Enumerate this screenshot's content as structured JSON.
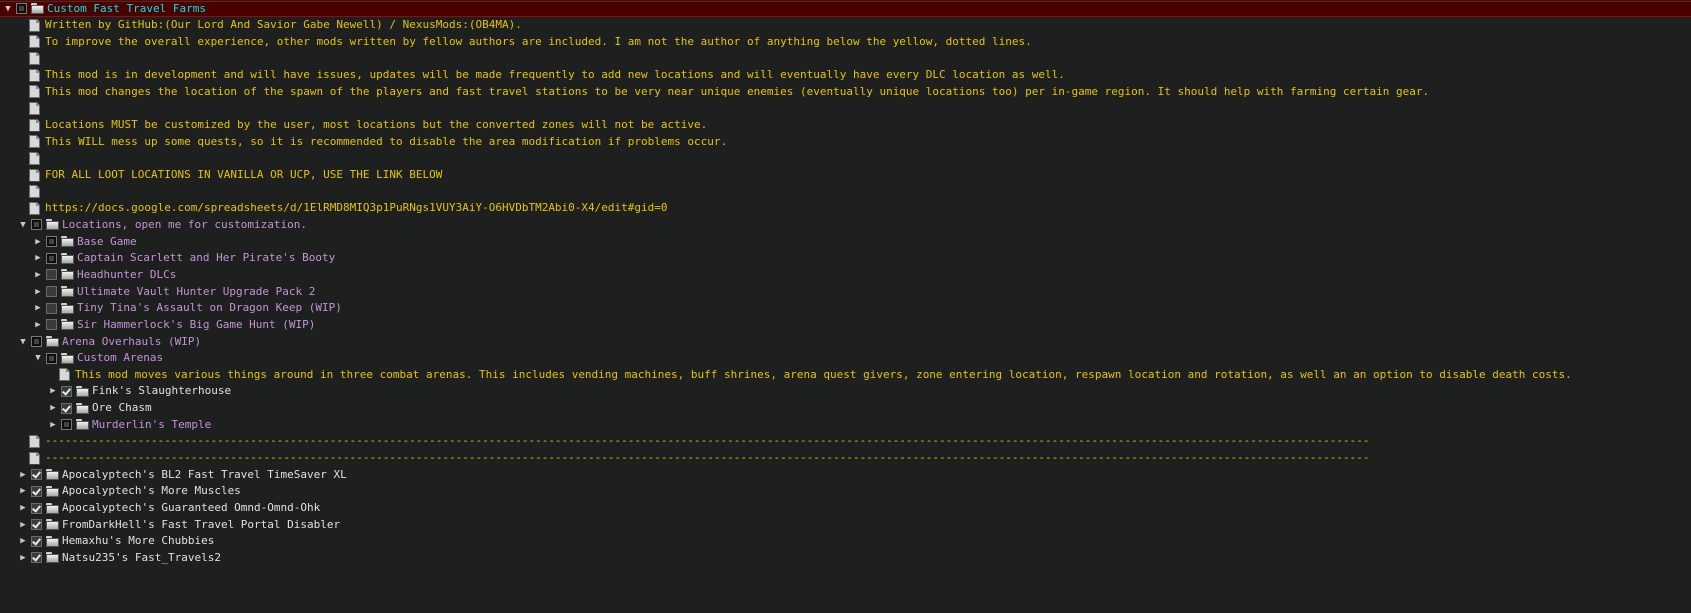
{
  "colors": {
    "background": "#1e1f1f",
    "selected_row": "#4a0000",
    "root_text": "#00e6e6",
    "note_text": "#e6c400",
    "category_text": "#c493d6",
    "mod_text": "#e0e0e0"
  },
  "tree": {
    "rows": [
      {
        "label": "Custom Fast Travel Farms",
        "type": "folder",
        "depth": 0,
        "expander": "expanded",
        "check": "partial",
        "color": "cyan",
        "selected": true
      },
      {
        "label": "Written by GitHub:(Our Lord And Savior Gabe Newell) / NexusMods:(OB4MA).",
        "type": "doc",
        "depth": 1,
        "color": "yellow"
      },
      {
        "label": "To improve the overall experience, other mods written by fellow authors are included.  I am not the author of anything below the yellow, dotted lines.",
        "type": "doc",
        "depth": 1,
        "color": "yellow"
      },
      {
        "label": "",
        "type": "doc",
        "depth": 1,
        "color": "yellow"
      },
      {
        "label": "This mod is in development and will have issues, updates will be made frequently to add new locations and will eventually have every DLC location as well.",
        "type": "doc",
        "depth": 1,
        "color": "yellow"
      },
      {
        "label": "This mod changes the location of the spawn of the players and fast travel stations to be very near unique enemies (eventually unique locations too) per in-game region.  It should help with farming certain gear.",
        "type": "doc",
        "depth": 1,
        "color": "yellow"
      },
      {
        "label": "",
        "type": "doc",
        "depth": 1,
        "color": "yellow"
      },
      {
        "label": "Locations MUST be customized by the user, most locations but the converted zones will not be active.",
        "type": "doc",
        "depth": 1,
        "color": "yellow"
      },
      {
        "label": "This WILL mess up some quests, so it is recommended to disable the area modification if problems occur.",
        "type": "doc",
        "depth": 1,
        "color": "yellow"
      },
      {
        "label": "",
        "type": "doc",
        "depth": 1,
        "color": "yellow"
      },
      {
        "label": "FOR ALL LOOT LOCATIONS IN VANILLA OR UCP, USE THE LINK BELOW",
        "type": "doc",
        "depth": 1,
        "color": "yellow"
      },
      {
        "label": "",
        "type": "doc",
        "depth": 1,
        "color": "yellow"
      },
      {
        "label": "https://docs.google.com/spreadsheets/d/1ElRMD8MIQ3p1PuRNgs1VUY3AiY-O6HVDbTM2Abi0-X4/edit#gid=0",
        "type": "doc",
        "depth": 1,
        "color": "yellow"
      },
      {
        "label": "Locations, open me for customization.",
        "type": "folder",
        "depth": 1,
        "expander": "expanded",
        "check": "partial",
        "color": "purple"
      },
      {
        "label": "Base Game",
        "type": "folder",
        "depth": 2,
        "expander": "collapsed",
        "check": "partial",
        "color": "purple"
      },
      {
        "label": "Captain Scarlett and Her Pirate's Booty",
        "type": "folder",
        "depth": 2,
        "expander": "collapsed",
        "check": "partial",
        "color": "purple"
      },
      {
        "label": "Headhunter DLCs",
        "type": "folder",
        "depth": 2,
        "expander": "collapsed",
        "check": "unchecked",
        "color": "purple"
      },
      {
        "label": "Ultimate Vault Hunter Upgrade Pack 2",
        "type": "folder",
        "depth": 2,
        "expander": "collapsed",
        "check": "unchecked",
        "color": "purple"
      },
      {
        "label": "Tiny Tina's Assault on Dragon Keep (WIP)",
        "type": "folder",
        "depth": 2,
        "expander": "collapsed",
        "check": "unchecked",
        "color": "purple"
      },
      {
        "label": "Sir Hammerlock's Big Game Hunt (WIP)",
        "type": "folder",
        "depth": 2,
        "expander": "collapsed",
        "check": "unchecked",
        "color": "purple"
      },
      {
        "label": "Arena Overhauls (WIP)",
        "type": "folder",
        "depth": 1,
        "expander": "expanded",
        "check": "partial",
        "color": "purple"
      },
      {
        "label": "Custom Arenas",
        "type": "folder",
        "depth": 2,
        "expander": "expanded",
        "check": "partial",
        "color": "purple"
      },
      {
        "label": "This mod moves various things around in three combat arenas.  This includes vending machines, buff shrines, arena quest givers, zone entering location, respawn location and rotation, as well an an option to disable death costs.",
        "type": "doc",
        "depth": 3,
        "color": "yellow"
      },
      {
        "label": "Fink's Slaughterhouse",
        "type": "folder",
        "depth": 3,
        "expander": "collapsed",
        "check": "checked",
        "color": "white"
      },
      {
        "label": "Ore Chasm",
        "type": "folder",
        "depth": 3,
        "expander": "collapsed",
        "check": "checked",
        "color": "white"
      },
      {
        "label": "Murderlin's Temple",
        "type": "folder",
        "depth": 3,
        "expander": "collapsed",
        "check": "partial",
        "color": "purple"
      },
      {
        "label": "--------------------------------------------------------------------------------------------------------------------------------------------------------------------------------------------------------",
        "type": "doc",
        "depth": 1,
        "color": "yellow"
      },
      {
        "label": "--------------------------------------------------------------------------------------------------------------------------------------------------------------------------------------------------------",
        "type": "doc",
        "depth": 1,
        "color": "yellow"
      },
      {
        "label": "Apocalyptech's BL2 Fast Travel TimeSaver XL",
        "type": "folder",
        "depth": 1,
        "expander": "collapsed",
        "check": "checked",
        "color": "white"
      },
      {
        "label": "Apocalyptech's More Muscles",
        "type": "folder",
        "depth": 1,
        "expander": "collapsed",
        "check": "checked",
        "color": "white"
      },
      {
        "label": "Apocalyptech's Guaranteed Omnd-Omnd-Ohk",
        "type": "folder",
        "depth": 1,
        "expander": "collapsed",
        "check": "checked",
        "color": "white"
      },
      {
        "label": "FromDarkHell's Fast Travel Portal Disabler",
        "type": "folder",
        "depth": 1,
        "expander": "collapsed",
        "check": "checked",
        "color": "white"
      },
      {
        "label": "Hemaxhu's More Chubbies",
        "type": "folder",
        "depth": 1,
        "expander": "collapsed",
        "check": "checked",
        "color": "white"
      },
      {
        "label": "Natsu235's Fast_Travels2",
        "type": "folder",
        "depth": 1,
        "expander": "collapsed",
        "check": "checked",
        "color": "white"
      }
    ]
  }
}
